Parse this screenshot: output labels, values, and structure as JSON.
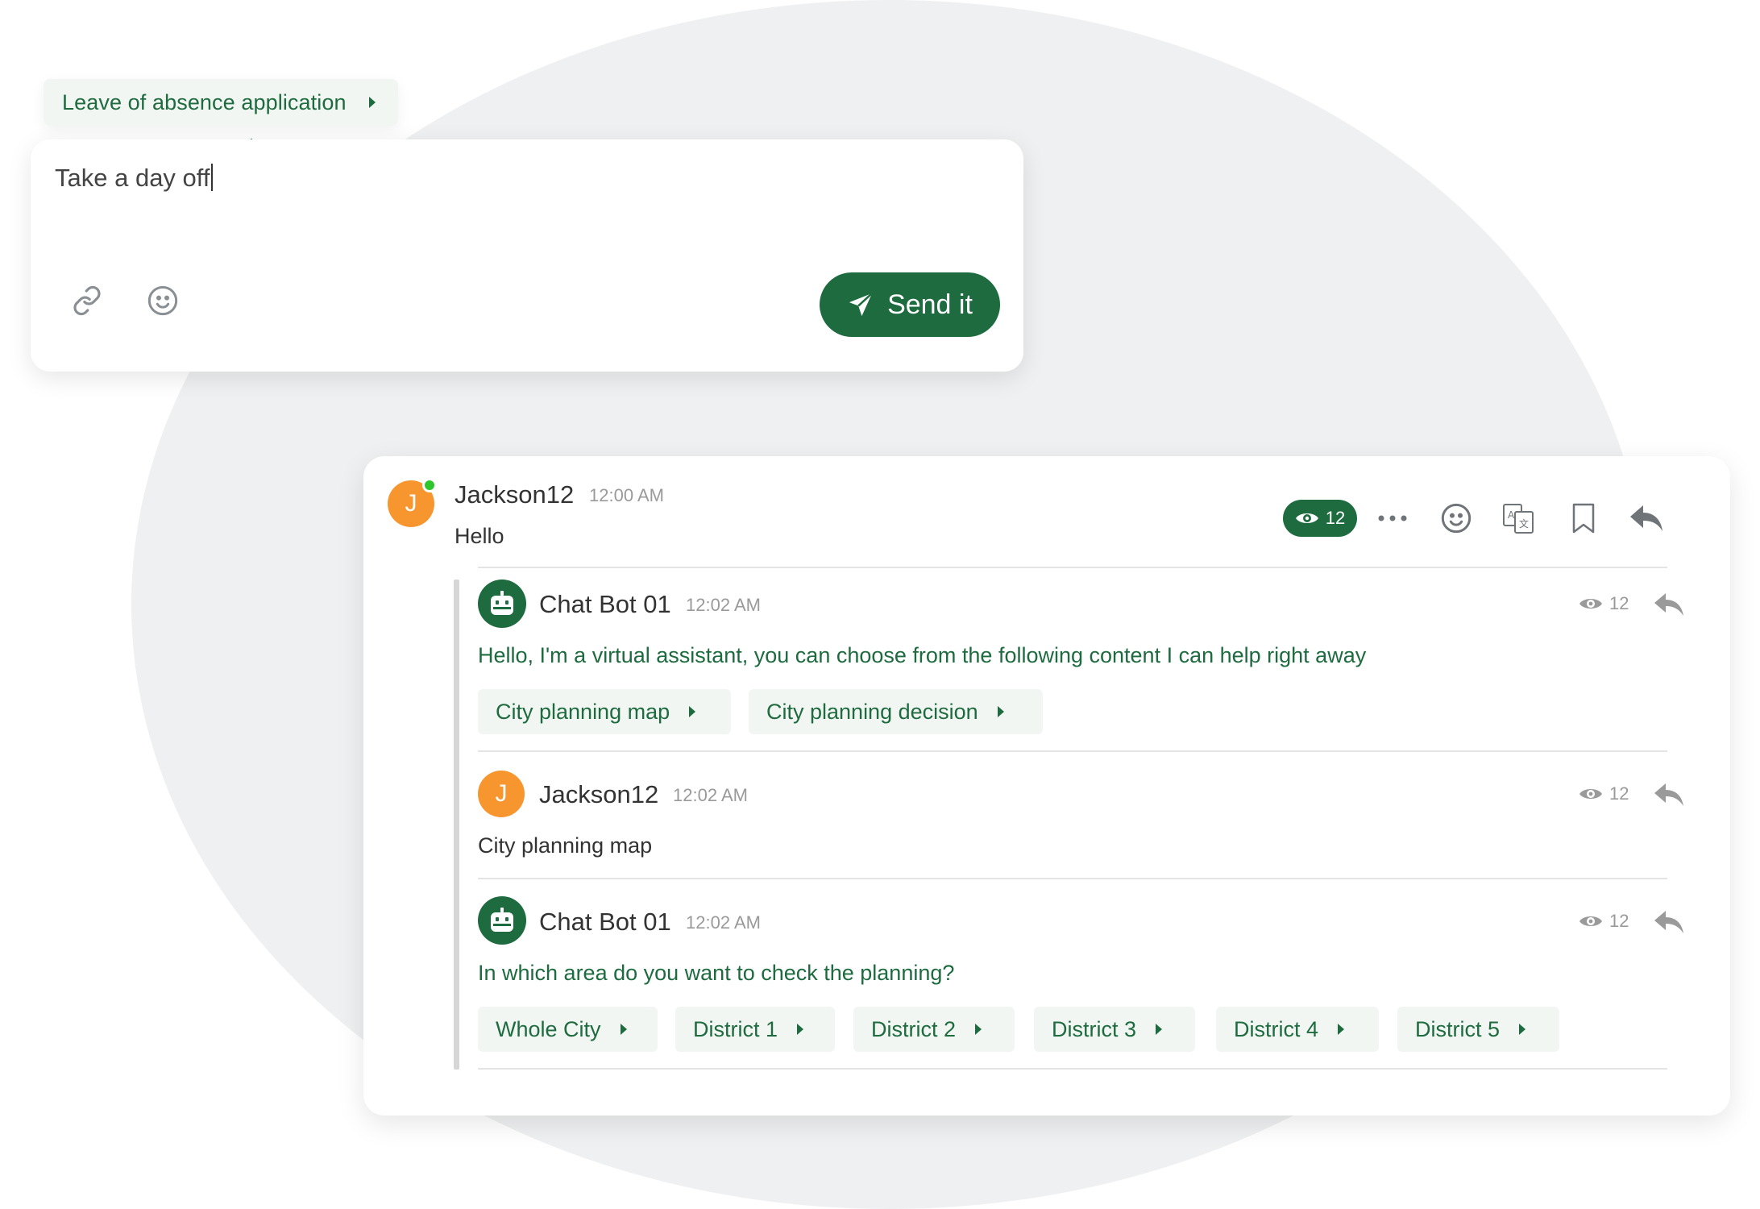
{
  "suggestion": {
    "label": "Leave of absence application",
    "icon": "caret-right-icon"
  },
  "composer": {
    "input_value": "Take a day off",
    "link_icon": "link-icon",
    "emoji_icon": "smile-icon",
    "send_label": "Send it",
    "send_icon": "paper-plane-icon"
  },
  "thread": {
    "root": {
      "avatar_letter": "J",
      "author": "Jackson12",
      "time": "12:00 AM",
      "text": "Hello",
      "seen_count": "12",
      "actions": [
        "more-icon",
        "emoji-icon",
        "translate-icon",
        "bookmark-icon",
        "reply-icon"
      ]
    },
    "replies": [
      {
        "type": "bot",
        "author": "Chat Bot 01",
        "time": "12:02 AM",
        "text": "Hello, I'm a virtual assistant, you can choose from the following content I can help right away",
        "seen_count": "12",
        "options": [
          "City planning map",
          "City planning decision"
        ]
      },
      {
        "type": "user",
        "avatar_letter": "J",
        "author": "Jackson12",
        "time": "12:02 AM",
        "text": "City planning map",
        "seen_count": "12"
      },
      {
        "type": "bot",
        "author": "Chat Bot 01",
        "time": "12:02 AM",
        "text": "In which area do you want to check the planning?",
        "seen_count": "12",
        "options": [
          "Whole City",
          "District 1",
          "District 2",
          "District 3",
          "District 4",
          "District 5"
        ]
      }
    ]
  },
  "colors": {
    "brand_green": "#1d6b3f",
    "avatar_orange": "#f7962f",
    "online_green": "#2dc72d",
    "chip_bg": "#f2f6f3",
    "background_circle": "#eff0f1"
  }
}
